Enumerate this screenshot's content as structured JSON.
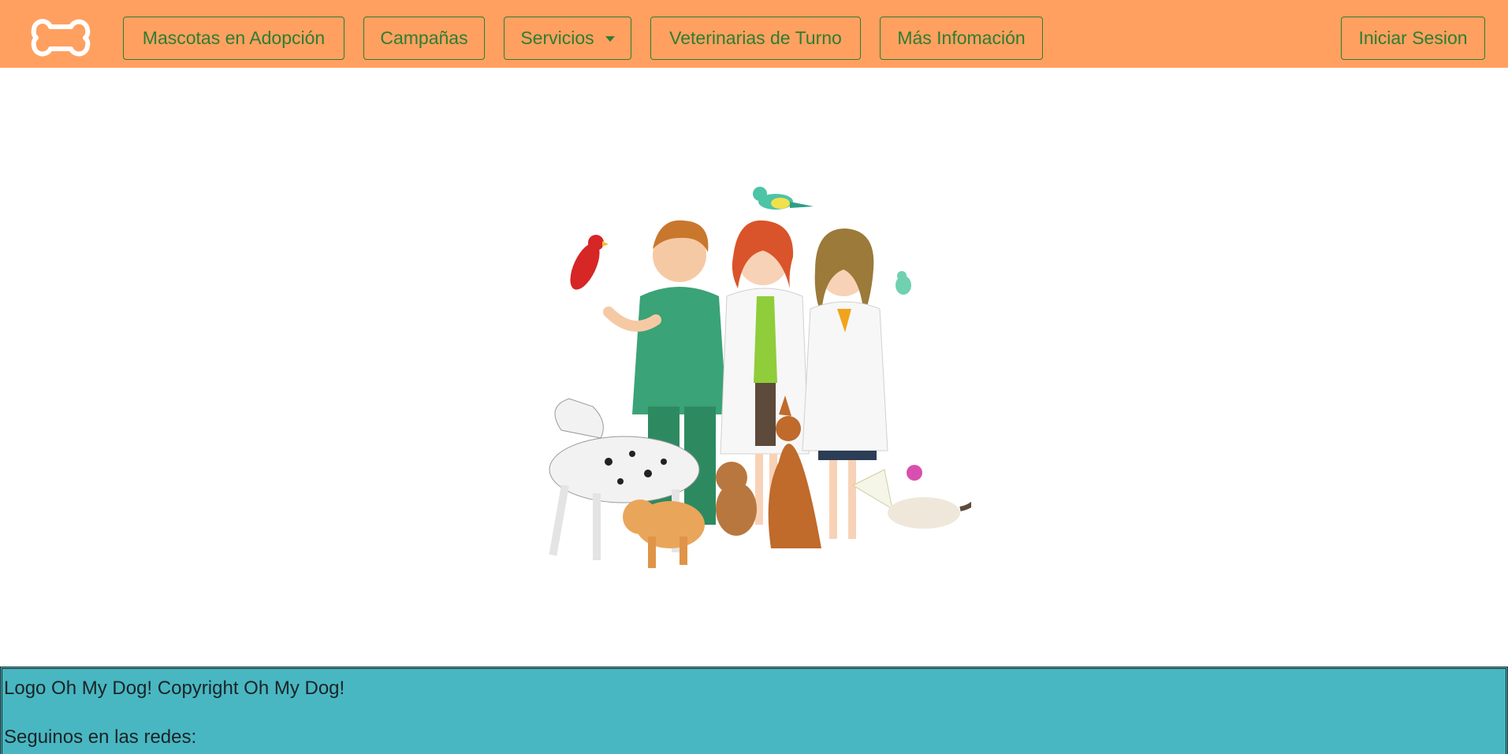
{
  "nav": {
    "logo_icon": "bone-icon",
    "items": [
      {
        "label": "Mascotas en Adopción"
      },
      {
        "label": "Campañas"
      },
      {
        "label": "Servicios",
        "has_dropdown": true
      },
      {
        "label": "Veterinarias de Turno"
      },
      {
        "label": "Más Infomación"
      }
    ],
    "login_label": "Iniciar Sesion"
  },
  "hero": {
    "illustration": "veterinarians-with-pets-illustration"
  },
  "footer": {
    "line1": "Logo Oh My Dog! Copyright Oh My Dog!",
    "line2": "Seguinos en las redes:"
  },
  "colors": {
    "navbar": "#ffa060",
    "nav_text": "#2e7d32",
    "footer": "#48b7c2"
  }
}
